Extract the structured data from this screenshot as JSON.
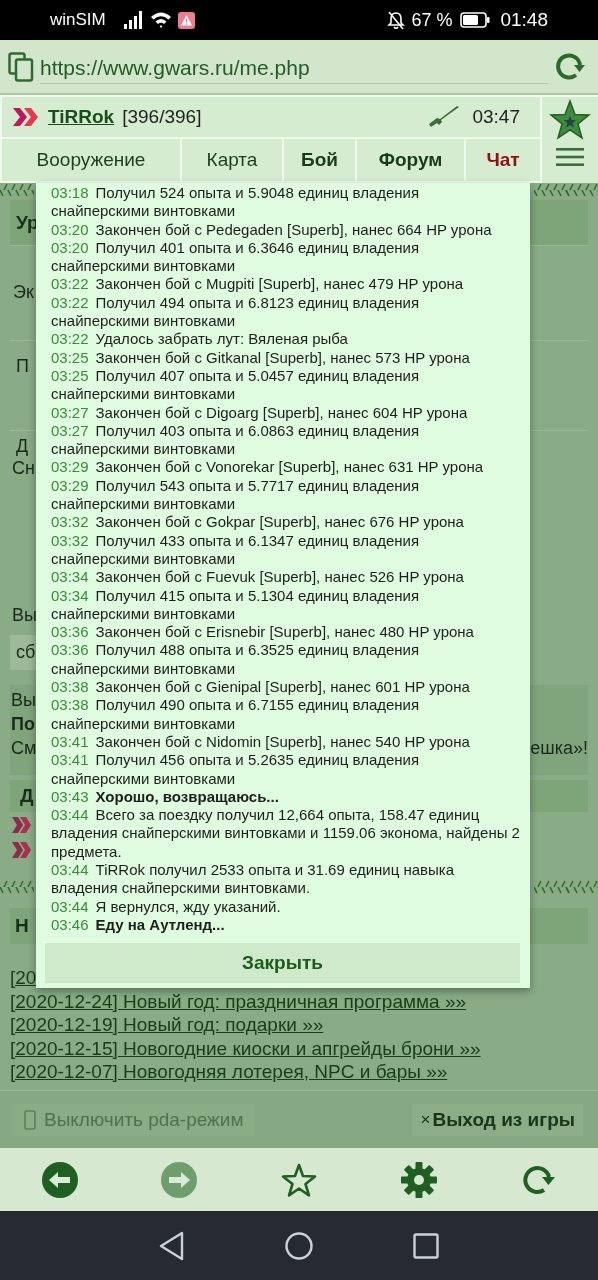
{
  "status_bar": {
    "carrier": "winSIM",
    "battery": "67 %",
    "time": "01:48"
  },
  "address_bar": {
    "url": "https://www.gwars.ru/me.php"
  },
  "header": {
    "player": "TiRRok",
    "hp": "[396/396]",
    "timer": "03:47"
  },
  "nav_tabs": [
    {
      "label": "Вооружение",
      "kind": "plain"
    },
    {
      "label": "Карта",
      "kind": "plain"
    },
    {
      "label": "Бой",
      "kind": "bold"
    },
    {
      "label": "Форум",
      "kind": "bold"
    },
    {
      "label": "Чат",
      "kind": "alert"
    }
  ],
  "page": {
    "stats_panel": {
      "header": "Ур",
      "rows": [
        {
          "lines": [
            "Эк"
          ]
        },
        {
          "lines": [
            "П"
          ]
        },
        {
          "lines": [
            "Д",
            "Сн"
          ]
        }
      ]
    },
    "choice": {
      "label": "Вы",
      "field": "сб"
    },
    "notice": {
      "lines": [
        {
          "text": "Вы",
          "bold": false
        },
        {
          "text": "По",
          "bold": true
        },
        {
          "text": "См",
          "bold": false
        }
      ],
      "tail": "ешка»!"
    },
    "links_panel": {
      "header": "Д",
      "rows": [
        {
          "kind": "chevron"
        },
        {
          "kind": "chevron"
        }
      ]
    },
    "news": {
      "header": "Н",
      "links": [
        "[20",
        "[2020-12-24] Новый год: праздничная программа »»",
        "[2020-12-19] Новый год: подарки »»",
        "[2020-12-15] Новогодние киоски и апгрейды брони »»",
        "[2020-12-07] Новогодняя лотерея, NPC и бары »»"
      ]
    },
    "footer": {
      "pda_button": "Выключить pda-режим",
      "exit_icon": "×",
      "exit_button": "Выход из игры"
    }
  },
  "log_dialog": {
    "entries": [
      {
        "time": "03:18",
        "text": "Получил 524 опыта и 5.9048 единиц владения снайперскими винтовками",
        "bold": false
      },
      {
        "time": "03:20",
        "text": "Закончен бой с Pedegaden [Superb], нанес 664 HP урона",
        "bold": false
      },
      {
        "time": "03:20",
        "text": "Получил 401 опыта и 6.3646 единиц владения снайперскими винтовками",
        "bold": false
      },
      {
        "time": "03:22",
        "text": "Закончен бой с Mugpiti [Superb], нанес 479 HP урона",
        "bold": false
      },
      {
        "time": "03:22",
        "text": "Получил 494 опыта и 6.8123 единиц владения снайперскими винтовками",
        "bold": false
      },
      {
        "time": "03:22",
        "text": "Удалось забрать лут: Вяленая рыба",
        "bold": false
      },
      {
        "time": "03:25",
        "text": "Закончен бой с Gitkanal [Superb], нанес 573 HP урона",
        "bold": false
      },
      {
        "time": "03:25",
        "text": "Получил 407 опыта и 5.0457 единиц владения снайперскими винтовками",
        "bold": false
      },
      {
        "time": "03:27",
        "text": "Закончен бой с Digoarg [Superb], нанес 604 HP урона",
        "bold": false
      },
      {
        "time": "03:27",
        "text": "Получил 403 опыта и 6.0863 единиц владения снайперскими винтовками",
        "bold": false
      },
      {
        "time": "03:29",
        "text": "Закончен бой с Vonorekar [Superb], нанес 631 HP урона",
        "bold": false
      },
      {
        "time": "03:29",
        "text": "Получил 543 опыта и 5.7717 единиц владения снайперскими винтовками",
        "bold": false
      },
      {
        "time": "03:32",
        "text": "Закончен бой с Gokpar [Superb], нанес 676 HP урона",
        "bold": false
      },
      {
        "time": "03:32",
        "text": "Получил 433 опыта и 6.1347 единиц владения снайперскими винтовками",
        "bold": false
      },
      {
        "time": "03:34",
        "text": "Закончен бой с Fuevuk [Superb], нанес 526 HP урона",
        "bold": false
      },
      {
        "time": "03:34",
        "text": "Получил 415 опыта и 5.1304 единиц владения снайперскими винтовками",
        "bold": false
      },
      {
        "time": "03:36",
        "text": "Закончен бой с Erisnebir [Superb], нанес 480 HP урона",
        "bold": false
      },
      {
        "time": "03:36",
        "text": "Получил 488 опыта и 6.3525 единиц владения снайперскими винтовками",
        "bold": false
      },
      {
        "time": "03:38",
        "text": "Закончен бой с Gienipal [Superb], нанес 601 HP урона",
        "bold": false
      },
      {
        "time": "03:38",
        "text": "Получил 490 опыта и 6.7155 единиц владения снайперскими винтовками",
        "bold": false
      },
      {
        "time": "03:41",
        "text": "Закончен бой с Nidomin [Superb], нанес 540 HP урона",
        "bold": false
      },
      {
        "time": "03:41",
        "text": "Получил 456 опыта и 5.2635 единиц владения снайперскими винтовками",
        "bold": false
      },
      {
        "time": "03:43",
        "text": "Хорошо, возвращаюсь...",
        "bold": true
      },
      {
        "time": "03:44",
        "text": "Всего за поездку получил 12,664 опыта, 158.47 единиц владения снайперскими винтовками и 1159.06 эконома, найдены 2 предмета.",
        "bold": false
      },
      {
        "time": "03:44",
        "text": "TiRRok получил 2533 опыта и 31.69 единиц навыка владения снайперскими винтовками.",
        "bold": false
      },
      {
        "time": "03:44",
        "text": "Я вернулся, жду указаний.",
        "bold": false
      },
      {
        "time": "03:46",
        "text": "Еду на Аутленд...",
        "bold": true
      }
    ],
    "close_button": "Закрыть"
  },
  "browser_nav": [
    {
      "kind": "back",
      "disabled": false
    },
    {
      "kind": "forward",
      "disabled": true
    },
    {
      "kind": "bookmark",
      "disabled": false
    },
    {
      "kind": "settings",
      "disabled": false
    },
    {
      "kind": "reload",
      "disabled": false
    }
  ]
}
